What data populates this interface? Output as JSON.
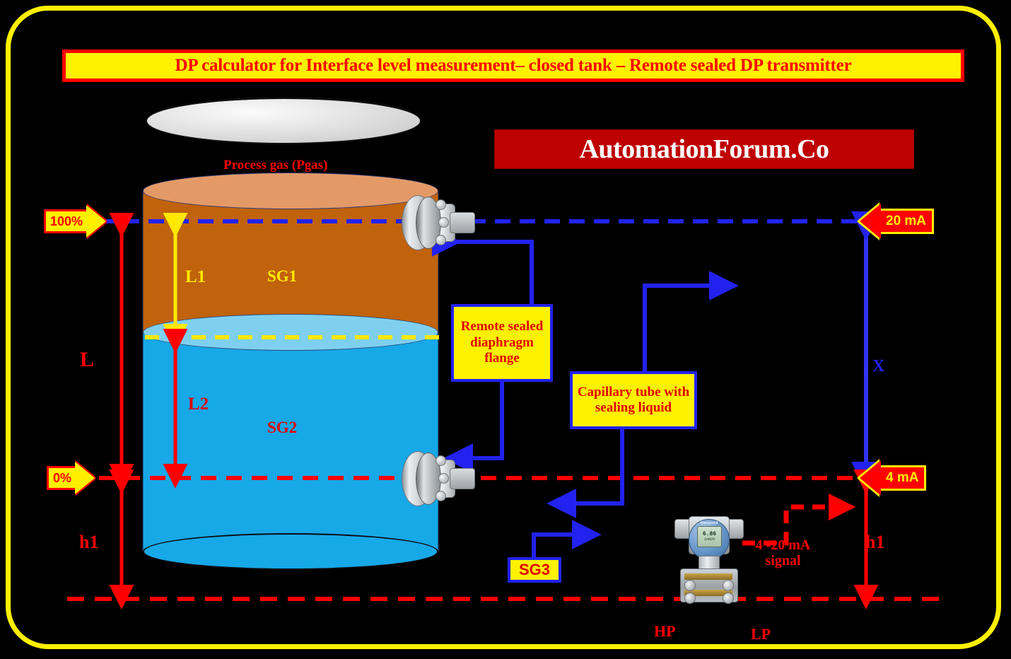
{
  "title": {
    "text": "DP calculator for Interface level measurement– closed tank – Remote sealed DP transmitter"
  },
  "logo": {
    "text": "AutomationForum.Co"
  },
  "tank": {
    "process_gas_label": "Process gas (Pgas)",
    "upper_fluid_sg": "SG1",
    "lower_fluid_sg": "SG2",
    "upper_height_label": "L1",
    "lower_height_label": "L2"
  },
  "dimensions": {
    "span_label": "L",
    "offset_left_label": "h1",
    "offset_right_label": "h1",
    "capillary_height_label": "X"
  },
  "range_markers": {
    "upper_percent": "100%",
    "lower_percent": "0%",
    "upper_current": "20 mA",
    "lower_current": "4 mA"
  },
  "callouts": {
    "flange": "Remote sealed diaphragm flange",
    "capillary": "Capillary tube with sealing liquid",
    "seal_fluid_sg": "SG3"
  },
  "transmitter": {
    "brand": "Honeywell",
    "display_value": "6.86",
    "display_units": "inH2O",
    "signal_label": "4 -20 mA signal",
    "high_port": "HP",
    "low_port": "LP"
  },
  "colors": {
    "frame": "#FFF000",
    "title_bg": "#FFF200",
    "title_text": "#FF0000",
    "logo_bg": "#BE0000",
    "upper_fluid": "#C1620C",
    "lower_fluid": "#17A8E8",
    "callout_border": "#2222F0",
    "reference_line": "#FF0000",
    "top_line": "#2222F0"
  }
}
